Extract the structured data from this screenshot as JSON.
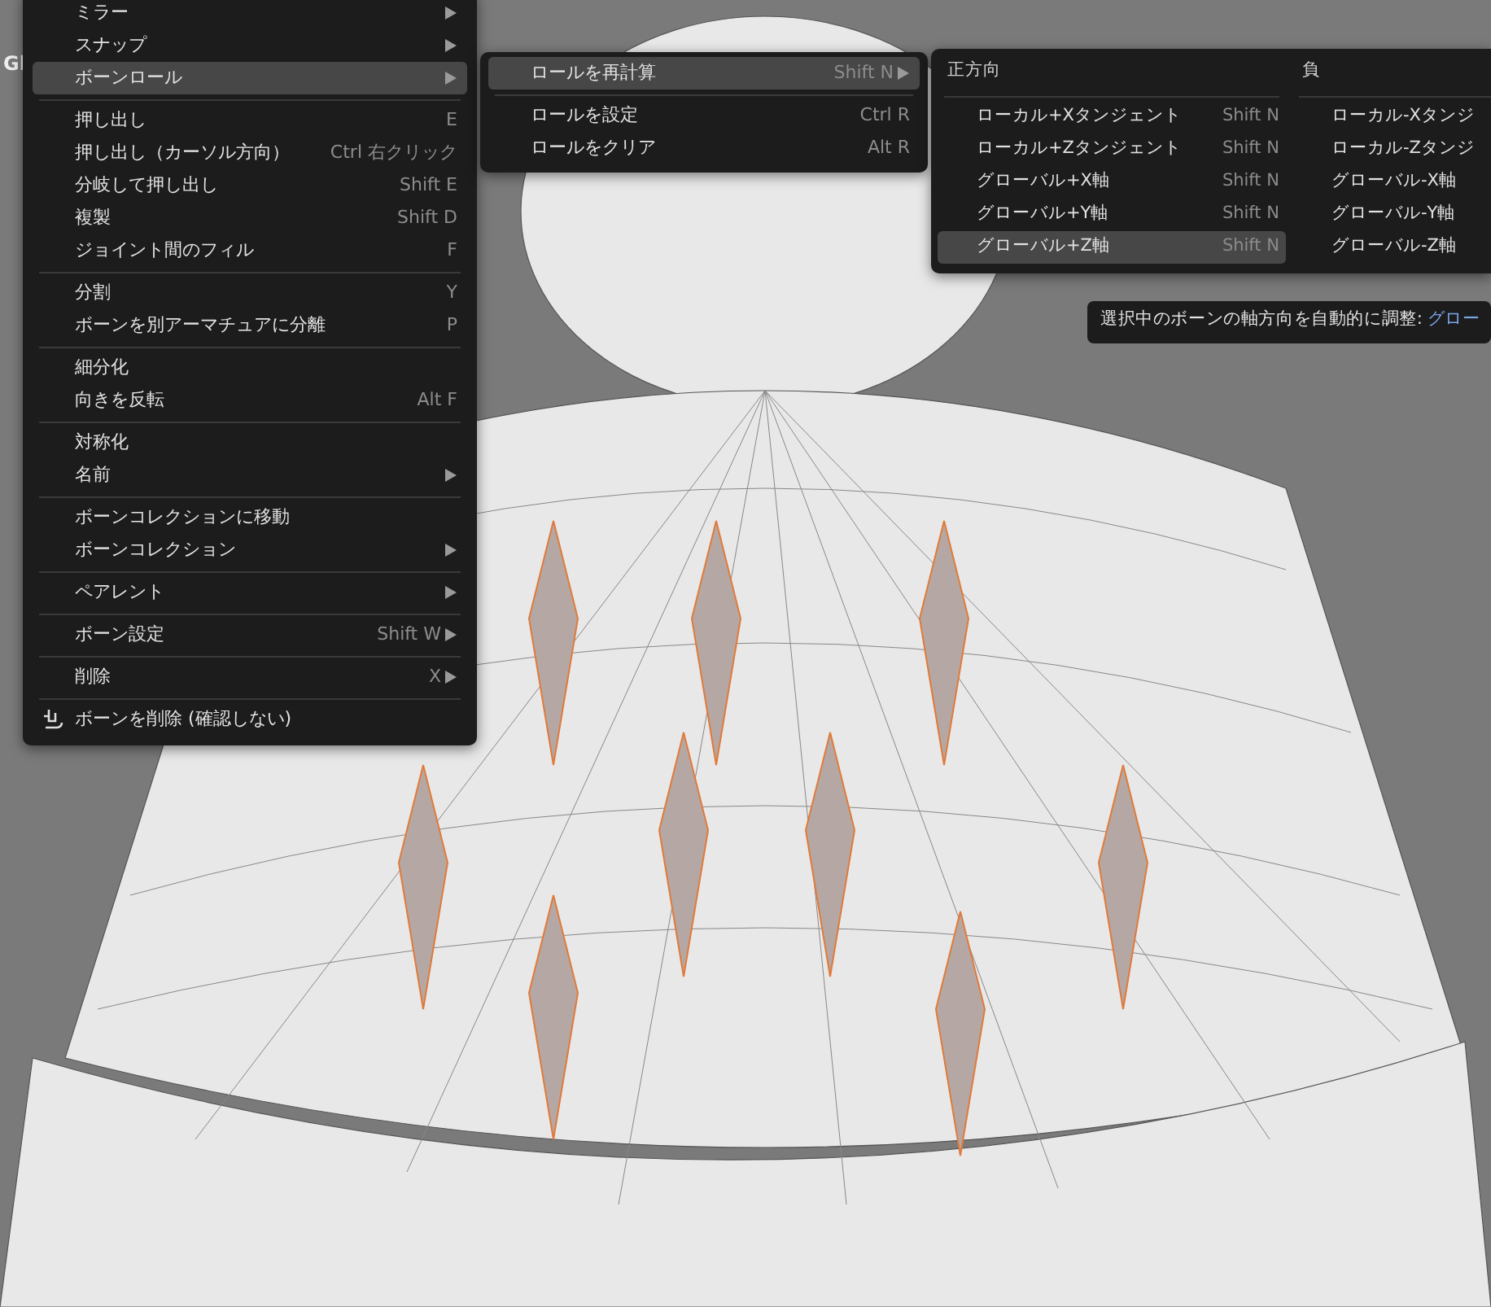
{
  "viewport": {
    "header_text": "Gl"
  },
  "main_menu": {
    "groups": [
      [
        {
          "label": "ミラー",
          "submenu": true,
          "selected": false,
          "kind": "plain"
        },
        {
          "label": "スナップ",
          "submenu": true,
          "selected": false,
          "kind": "plain"
        },
        {
          "label": "ボーンロール",
          "submenu": true,
          "selected": true,
          "kind": "plain"
        }
      ],
      [
        {
          "label": "押し出し",
          "shortcut": "E",
          "submenu": false,
          "selected": false,
          "kind": "plain"
        },
        {
          "label": "押し出し（カーソル方向）",
          "shortcut": "Ctrl 右クリック",
          "submenu": false,
          "selected": false,
          "kind": "plain"
        },
        {
          "label": "分岐して押し出し",
          "shortcut": "Shift E",
          "submenu": false,
          "selected": false,
          "kind": "plain"
        },
        {
          "label": "複製",
          "shortcut": "Shift D",
          "submenu": false,
          "selected": false,
          "kind": "plain"
        },
        {
          "label": "ジョイント間のフィル",
          "shortcut": "F",
          "submenu": false,
          "selected": false,
          "kind": "plain"
        }
      ],
      [
        {
          "label": "分割",
          "shortcut": "Y",
          "submenu": false,
          "selected": false,
          "kind": "plain"
        },
        {
          "label": "ボーンを別アーマチュアに分離",
          "shortcut": "P",
          "submenu": false,
          "selected": false,
          "kind": "plain"
        }
      ],
      [
        {
          "label": "細分化",
          "submenu": false,
          "selected": false,
          "kind": "plain"
        },
        {
          "label": "向きを反転",
          "shortcut": "Alt F",
          "submenu": false,
          "selected": false,
          "kind": "plain"
        }
      ],
      [
        {
          "label": "対称化",
          "submenu": false,
          "selected": false,
          "kind": "plain"
        },
        {
          "label": "名前",
          "submenu": true,
          "selected": false,
          "kind": "plain"
        }
      ],
      [
        {
          "label": "ボーンコレクションに移動",
          "submenu": false,
          "selected": false,
          "kind": "plain"
        },
        {
          "label": "ボーンコレクション",
          "submenu": true,
          "selected": false,
          "kind": "plain"
        }
      ],
      [
        {
          "label": "ペアレント",
          "submenu": true,
          "selected": false,
          "kind": "plain"
        }
      ],
      [
        {
          "label": "ボーン設定",
          "shortcut": "Shift W",
          "submenu": true,
          "selected": false,
          "kind": "plain"
        }
      ],
      [
        {
          "label": "削除",
          "shortcut": "X",
          "submenu": true,
          "selected": false,
          "kind": "plain"
        }
      ],
      [
        {
          "label": "ボーンを削除 (確認しない)",
          "submenu": false,
          "selected": false,
          "kind": "with-icon"
        }
      ]
    ]
  },
  "roll_menu": {
    "groups": [
      [
        {
          "label": "ロールを再計算",
          "shortcut": "Shift N",
          "submenu": true,
          "selected": true
        }
      ],
      [
        {
          "label": "ロールを設定",
          "shortcut": "Ctrl R",
          "submenu": false,
          "selected": false
        },
        {
          "label": "ロールをクリア",
          "shortcut": "Alt R",
          "submenu": false,
          "selected": false
        }
      ]
    ]
  },
  "axis_menu": {
    "columns": [
      {
        "heading": "正方向",
        "items": [
          {
            "label": "ローカル+Xタンジェント",
            "shortcut": "Shift N",
            "selected": false
          },
          {
            "label": "ローカル+Zタンジェント",
            "shortcut": "Shift N",
            "selected": false
          },
          {
            "label": "グローバル+X軸",
            "shortcut": "Shift N",
            "selected": false
          },
          {
            "label": "グローバル+Y軸",
            "shortcut": "Shift N",
            "selected": false
          },
          {
            "label": "グローバル+Z軸",
            "shortcut": "Shift N",
            "selected": true
          }
        ]
      },
      {
        "heading": "負",
        "items": [
          {
            "label": "ローカル-Xタンジ",
            "selected": false
          },
          {
            "label": "ローカル-Zタンジ",
            "selected": false
          },
          {
            "label": "グローバル-X軸",
            "selected": false
          },
          {
            "label": "グローバル-Y軸",
            "selected": false
          },
          {
            "label": "グローバル-Z軸",
            "selected": false
          }
        ]
      }
    ]
  },
  "tooltip": {
    "text": "選択中のボーンの軸方向を自動的に調整:",
    "value": "グロー"
  }
}
